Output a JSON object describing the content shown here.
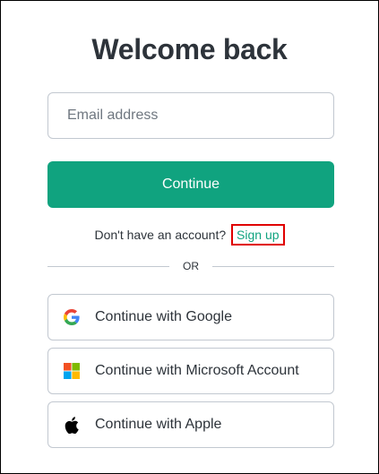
{
  "title": "Welcome back",
  "email": {
    "placeholder": "Email address",
    "value": ""
  },
  "continue_label": "Continue",
  "signup": {
    "prompt": "Don't have an account?",
    "link": "Sign up"
  },
  "divider_label": "OR",
  "social": [
    {
      "label": "Continue with Google",
      "icon": "google-icon"
    },
    {
      "label": "Continue with Microsoft Account",
      "icon": "microsoft-icon"
    },
    {
      "label": "Continue with Apple",
      "icon": "apple-icon"
    }
  ],
  "colors": {
    "accent": "#10a37f",
    "text": "#2d333a",
    "border": "#c2c8d0",
    "highlight": "#e00000"
  }
}
